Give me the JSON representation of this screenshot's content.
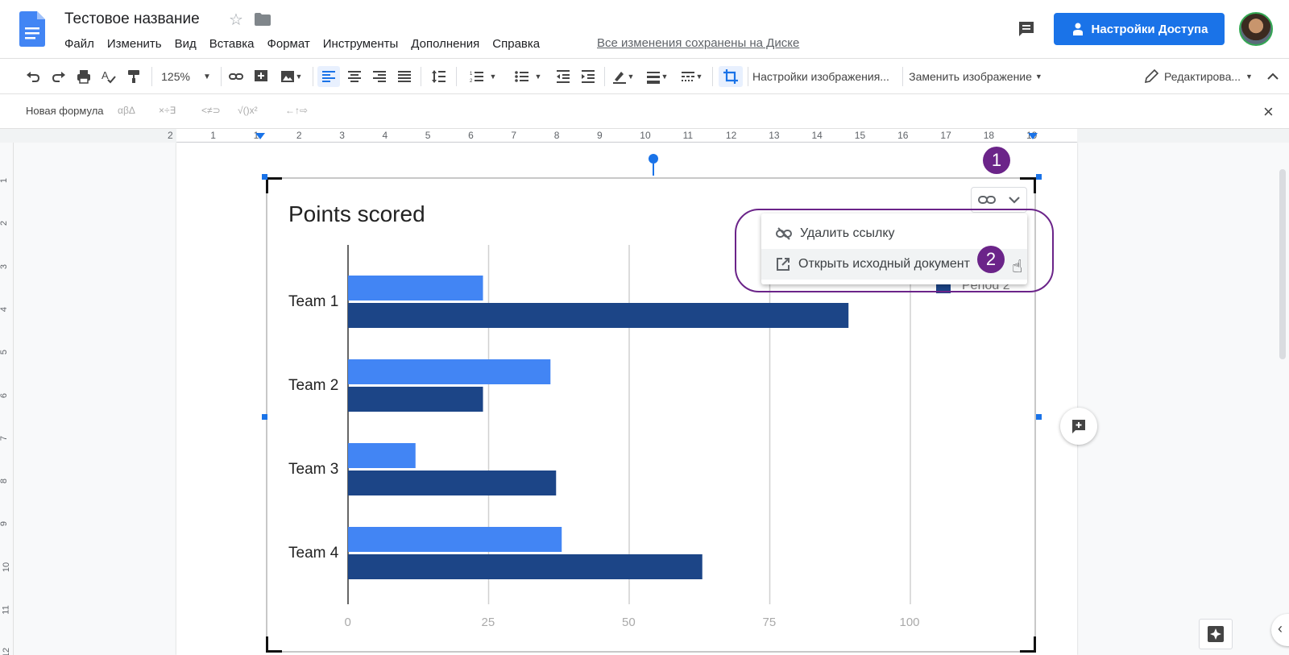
{
  "header": {
    "title": "Тестовое название",
    "menu": [
      "Файл",
      "Изменить",
      "Вид",
      "Вставка",
      "Формат",
      "Инструменты",
      "Дополнения",
      "Справка"
    ],
    "saved_status": "Все изменения сохранены на Диске",
    "share_label": "Настройки Доступа"
  },
  "toolbar": {
    "zoom": "125%",
    "image_options": "Настройки изображения...",
    "replace_image": "Заменить изображение",
    "editing_mode": "Редактирова..."
  },
  "equation_bar": {
    "new_equation": "Новая формула",
    "symbol_groups": [
      "αβΔ",
      "×÷∃",
      "<≠⊃",
      "√()x²",
      "←↑⇨"
    ]
  },
  "ruler": {
    "numbers": [
      "2",
      "1",
      "1",
      "2",
      "3",
      "4",
      "5",
      "6",
      "7",
      "8",
      "9",
      "10",
      "11",
      "12",
      "13",
      "14",
      "15",
      "16",
      "17",
      "18",
      "19"
    ],
    "vertical_numbers": [
      "1",
      "2",
      "3",
      "4",
      "5",
      "6",
      "7",
      "8",
      "9",
      "10",
      "11",
      "12"
    ]
  },
  "link_popup": {
    "remove_link": "Удалить ссылку",
    "open_source": "Открыть исходный документ"
  },
  "annotations": {
    "step1": "1",
    "step2": "2"
  },
  "chart_data": {
    "type": "bar",
    "orientation": "horizontal",
    "title": "Points scored",
    "categories": [
      "Team 1",
      "Team 2",
      "Team 3",
      "Team 4"
    ],
    "series": [
      {
        "name": "",
        "color": "#4285f4",
        "values": [
          24,
          36,
          12,
          38
        ]
      },
      {
        "name": "Period 2",
        "color": "#1c4587",
        "values": [
          89,
          24,
          37,
          63
        ]
      }
    ],
    "xlim": [
      0,
      125
    ],
    "x_ticks": [
      "0",
      "25",
      "50",
      "75",
      "100"
    ],
    "grid": true,
    "legend": "top-right"
  },
  "colors": {
    "accent": "#1a73e8",
    "annotation": "#6b2489"
  }
}
